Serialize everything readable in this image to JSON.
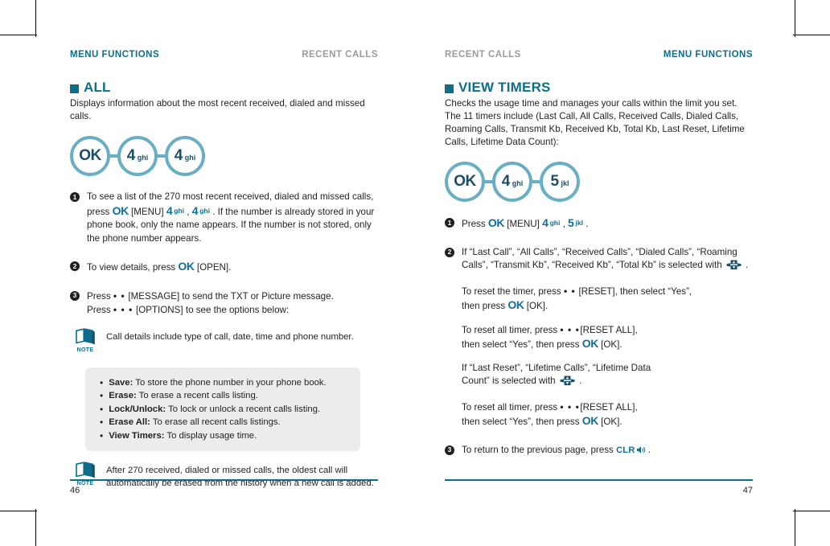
{
  "spread": {
    "left_page": {
      "running_head": {
        "left": "MENU FUNCTIONS",
        "right": "RECENT CALLS"
      },
      "section_title": "ALL",
      "intro": "Displays information about the most recent received, dialed and missed calls.",
      "keychain": [
        {
          "big": "OK",
          "small": ""
        },
        {
          "big": "4",
          "small": "ghi"
        },
        {
          "big": "4",
          "small": "ghi"
        }
      ],
      "steps": [
        {
          "num": "1",
          "parts": [
            {
              "t": "text",
              "v": "To see a list of the 270 most recent received, dialed and missed calls, press "
            },
            {
              "t": "ok",
              "v": "OK"
            },
            {
              "t": "text",
              "v": " [MENU] "
            },
            {
              "t": "key",
              "v": "4",
              "sub": "ghi"
            },
            {
              "t": "text",
              "v": " , "
            },
            {
              "t": "key",
              "v": "4",
              "sub": "ghi"
            },
            {
              "t": "text",
              "v": " . If the number is already stored in your phone book, only the name appears. If the number is not stored, only the phone number appears."
            }
          ]
        },
        {
          "num": "2",
          "parts": [
            {
              "t": "text",
              "v": "To view details, press "
            },
            {
              "t": "ok",
              "v": "OK"
            },
            {
              "t": "text",
              "v": " [OPEN]."
            }
          ]
        },
        {
          "num": "3",
          "parts": [
            {
              "t": "text",
              "v": "Press "
            },
            {
              "t": "dots",
              "v": "• •"
            },
            {
              "t": "text",
              "v": " [MESSAGE] to send the TXT or Picture message."
            },
            {
              "t": "br"
            },
            {
              "t": "text",
              "v": "Press "
            },
            {
              "t": "dots",
              "v": "• • •"
            },
            {
              "t": "text",
              "v": " [OPTIONS] to see the options below:"
            }
          ]
        }
      ],
      "note_1": {
        "label": "NOTE",
        "text": "Call details include type of call, date, time and phone number."
      },
      "options_box": [
        {
          "name": "Save:",
          "desc": " To store the phone number in your phone book."
        },
        {
          "name": "Erase:",
          "desc": " To erase a recent calls listing."
        },
        {
          "name": "Lock/Unlock:",
          "desc": " To lock or unlock a recent calls listing."
        },
        {
          "name": "Erase All:",
          "desc": " To erase all recent calls listings."
        },
        {
          "name": "View Timers:",
          "desc": " To display usage time."
        }
      ],
      "note_2": {
        "label": "NOTE",
        "text": "After 270 received, dialed or missed calls, the oldest call will automatically be erased from the history when a new call is added."
      },
      "page_number": "46"
    },
    "right_page": {
      "running_head": {
        "left": "RECENT CALLS",
        "right": "MENU FUNCTIONS"
      },
      "section_title": "VIEW TIMERS",
      "intro": "Checks the usage time and manages your calls within the limit you set. The 11 timers include (Last Call, All Calls, Received Calls, Dialed Calls, Roaming Calls, Transmit Kb, Received Kb, Total Kb, Last Reset, Lifetime Calls, Lifetime Data Count):",
      "keychain": [
        {
          "big": "OK",
          "small": ""
        },
        {
          "big": "4",
          "small": "ghi"
        },
        {
          "big": "5",
          "small": "jkl"
        }
      ],
      "steps": [
        {
          "num": "1",
          "parts": [
            {
              "t": "text",
              "v": "Press "
            },
            {
              "t": "ok",
              "v": "OK"
            },
            {
              "t": "text",
              "v": " [MENU] "
            },
            {
              "t": "key",
              "v": "4",
              "sub": "ghi"
            },
            {
              "t": "text",
              "v": " , "
            },
            {
              "t": "key",
              "v": "5",
              "sub": "jkl"
            },
            {
              "t": "text",
              "v": " ."
            }
          ]
        },
        {
          "num": "2",
          "parts": [
            {
              "t": "text",
              "v": "If “Last Call”, “All Calls”, “Received Calls”, “Dialed Calls”, “Roaming Calls”, “Transmit Kb”, “Received Kb”, “Total Kb” is selected with "
            },
            {
              "t": "nav"
            },
            {
              "t": "text",
              "v": " ."
            }
          ]
        }
      ],
      "substeps": [
        [
          {
            "t": "text",
            "v": "To reset the timer, press "
          },
          {
            "t": "dots",
            "v": "• •"
          },
          {
            "t": "text",
            "v": " [RESET], then select “Yes”,"
          },
          {
            "t": "br"
          },
          {
            "t": "text",
            "v": "then press "
          },
          {
            "t": "ok",
            "v": "OK"
          },
          {
            "t": "text",
            "v": " [OK]."
          }
        ],
        [
          {
            "t": "text",
            "v": "To reset all timer, press "
          },
          {
            "t": "dots",
            "v": "• • •"
          },
          {
            "t": "text",
            "v": "[RESET ALL],"
          },
          {
            "t": "br"
          },
          {
            "t": "text",
            "v": "then select “Yes”, then press "
          },
          {
            "t": "ok",
            "v": "OK"
          },
          {
            "t": "text",
            "v": " [OK]."
          }
        ],
        [
          {
            "t": "text",
            "v": "If “Last Reset”, “Lifetime Calls”, “Lifetime Data"
          },
          {
            "t": "br"
          },
          {
            "t": "text",
            "v": "Count” is selected with "
          },
          {
            "t": "nav"
          },
          {
            "t": "text",
            "v": " ."
          }
        ],
        [
          {
            "t": "text",
            "v": "To reset all timer, press "
          },
          {
            "t": "dots",
            "v": "• • •"
          },
          {
            "t": "text",
            "v": "[RESET ALL],"
          },
          {
            "t": "br"
          },
          {
            "t": "text",
            "v": "then select “Yes”, then press "
          },
          {
            "t": "ok",
            "v": "OK"
          },
          {
            "t": "text",
            "v": " [OK]."
          }
        ]
      ],
      "final_step": {
        "num": "3",
        "parts": [
          {
            "t": "text",
            "v": "To return to the previous page, press "
          },
          {
            "t": "clr",
            "v": "CLR"
          },
          {
            "t": "text",
            "v": " ."
          }
        ]
      },
      "page_number": "47"
    }
  },
  "colors": {
    "accent": "#0d6e8c",
    "key_ring": "#6aaec4",
    "key_text": "#1d4e68",
    "blue_key_label": "#0f6f9a",
    "gray_box": "#ececec",
    "passive_head": "#9b9b9b",
    "body_text": "#231f20"
  }
}
